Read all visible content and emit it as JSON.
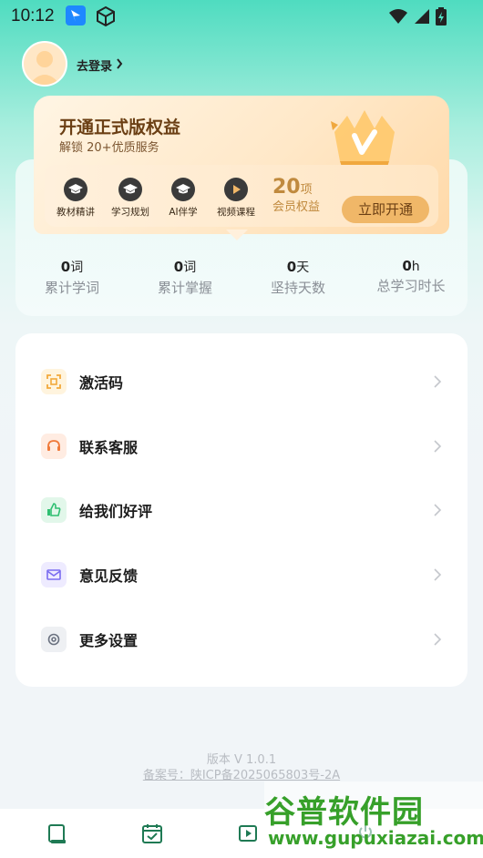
{
  "status_bar": {
    "time": "10:12",
    "icons": [
      "app-notification-icon",
      "box-icon",
      "wifi-icon",
      "signal-icon",
      "battery-icon"
    ]
  },
  "profile": {
    "login_label": "去登录"
  },
  "vip": {
    "title": "开通正式版权益",
    "subtitle": "解锁 20+优质服务",
    "benefits": [
      {
        "label": "教材精讲",
        "icon": "graduation-cap-icon"
      },
      {
        "label": "学习规划",
        "icon": "graduation-cap-icon"
      },
      {
        "label": "AI伴学",
        "icon": "graduation-cap-icon"
      },
      {
        "label": "视频课程",
        "icon": "play-icon"
      }
    ],
    "count": "20",
    "count_unit": "项",
    "count_label": "会员权益",
    "open_button": "立即开通",
    "colors": {
      "accent": "#f0b768",
      "text": "#6b3f14",
      "highlight": "#c08a3e"
    }
  },
  "stats": [
    {
      "value": "0",
      "unit": "词",
      "label": "累计学词"
    },
    {
      "value": "0",
      "unit": "词",
      "label": "累计掌握"
    },
    {
      "value": "0",
      "unit": "天",
      "label": "坚持天数"
    },
    {
      "value": "0",
      "unit": "h",
      "label": "总学习时长"
    }
  ],
  "menu": [
    {
      "label": "激活码",
      "icon": "scan-code-icon",
      "color": "#f2a93b",
      "bg": "#fff4de"
    },
    {
      "label": "联系客服",
      "icon": "headset-icon",
      "color": "#f07a3a",
      "bg": "#ffece2"
    },
    {
      "label": "给我们好评",
      "icon": "thumbs-up-icon",
      "color": "#2fbf71",
      "bg": "#e2f7ea"
    },
    {
      "label": "意见反馈",
      "icon": "feedback-mail-icon",
      "color": "#7a6cf0",
      "bg": "#eeebff"
    },
    {
      "label": "更多设置",
      "icon": "gear-icon",
      "color": "#6b7280",
      "bg": "#eef0f3"
    }
  ],
  "footer": {
    "version": "版本 V 1.0.1",
    "icp": "备案号：陕ICP备2025065803号-2A"
  },
  "bottom_nav": [
    {
      "icon": "book-icon"
    },
    {
      "icon": "calendar-check-icon"
    },
    {
      "icon": "video-icon"
    },
    {
      "icon": "power-icon"
    }
  ],
  "watermark": {
    "main": "谷普软件园",
    "sub": "www.gupuxiazai.com"
  }
}
